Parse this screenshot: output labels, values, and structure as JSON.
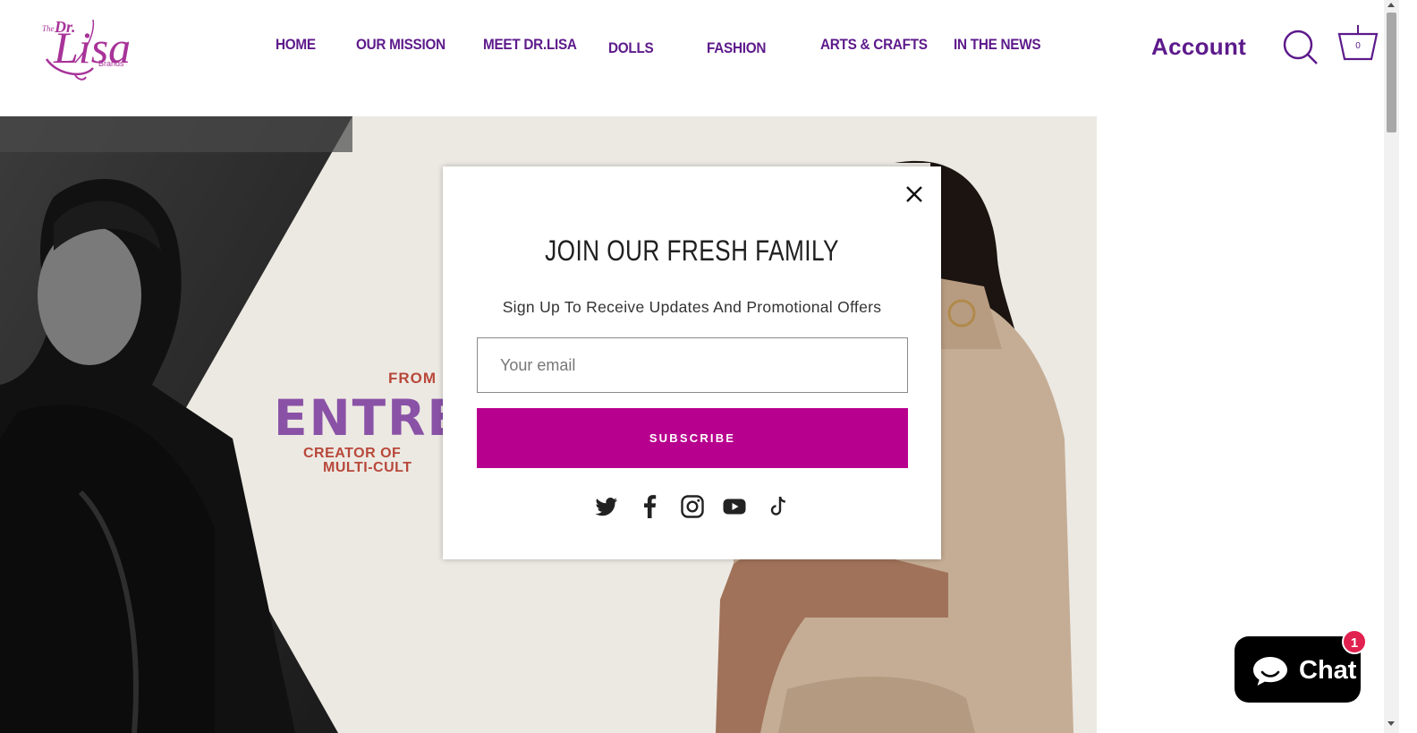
{
  "header": {
    "logo": {
      "the": "The",
      "dr": "Dr.",
      "lisa": "Lisa",
      "brands": "Brands"
    },
    "nav": [
      {
        "label": "HOME"
      },
      {
        "label": "OUR MISSION"
      },
      {
        "label": "MEET DR.LISA"
      },
      {
        "label": "DOLLS"
      },
      {
        "label": "FASHION"
      },
      {
        "label": "ARTS & CRAFTS"
      },
      {
        "label": "IN THE NEWS"
      }
    ],
    "account_label": "Account",
    "search_icon": "search-icon",
    "cart_icon": "basket-icon",
    "cart_count": "0",
    "nav_color": "#5d1a8b"
  },
  "hero": {
    "from": "FROM",
    "headline": "ENTRE",
    "creator": "CREATOR OF",
    "multi": "MULTI-CULT",
    "background": "#ece9e3"
  },
  "popup": {
    "title": "JOIN OUR FRESH FAMILY",
    "subtitle": "Sign Up To Receive Updates And Promotional Offers",
    "email_placeholder": "Your email",
    "subscribe_label": "SUBSCRIBE",
    "subscribe_color": "#b8008f",
    "close_icon": "close-icon",
    "social": [
      "twitter-icon",
      "facebook-icon",
      "instagram-icon",
      "youtube-icon",
      "tiktok-icon"
    ]
  },
  "chat": {
    "label": "Chat",
    "badge": "1",
    "icon": "chat-bubble-icon"
  }
}
